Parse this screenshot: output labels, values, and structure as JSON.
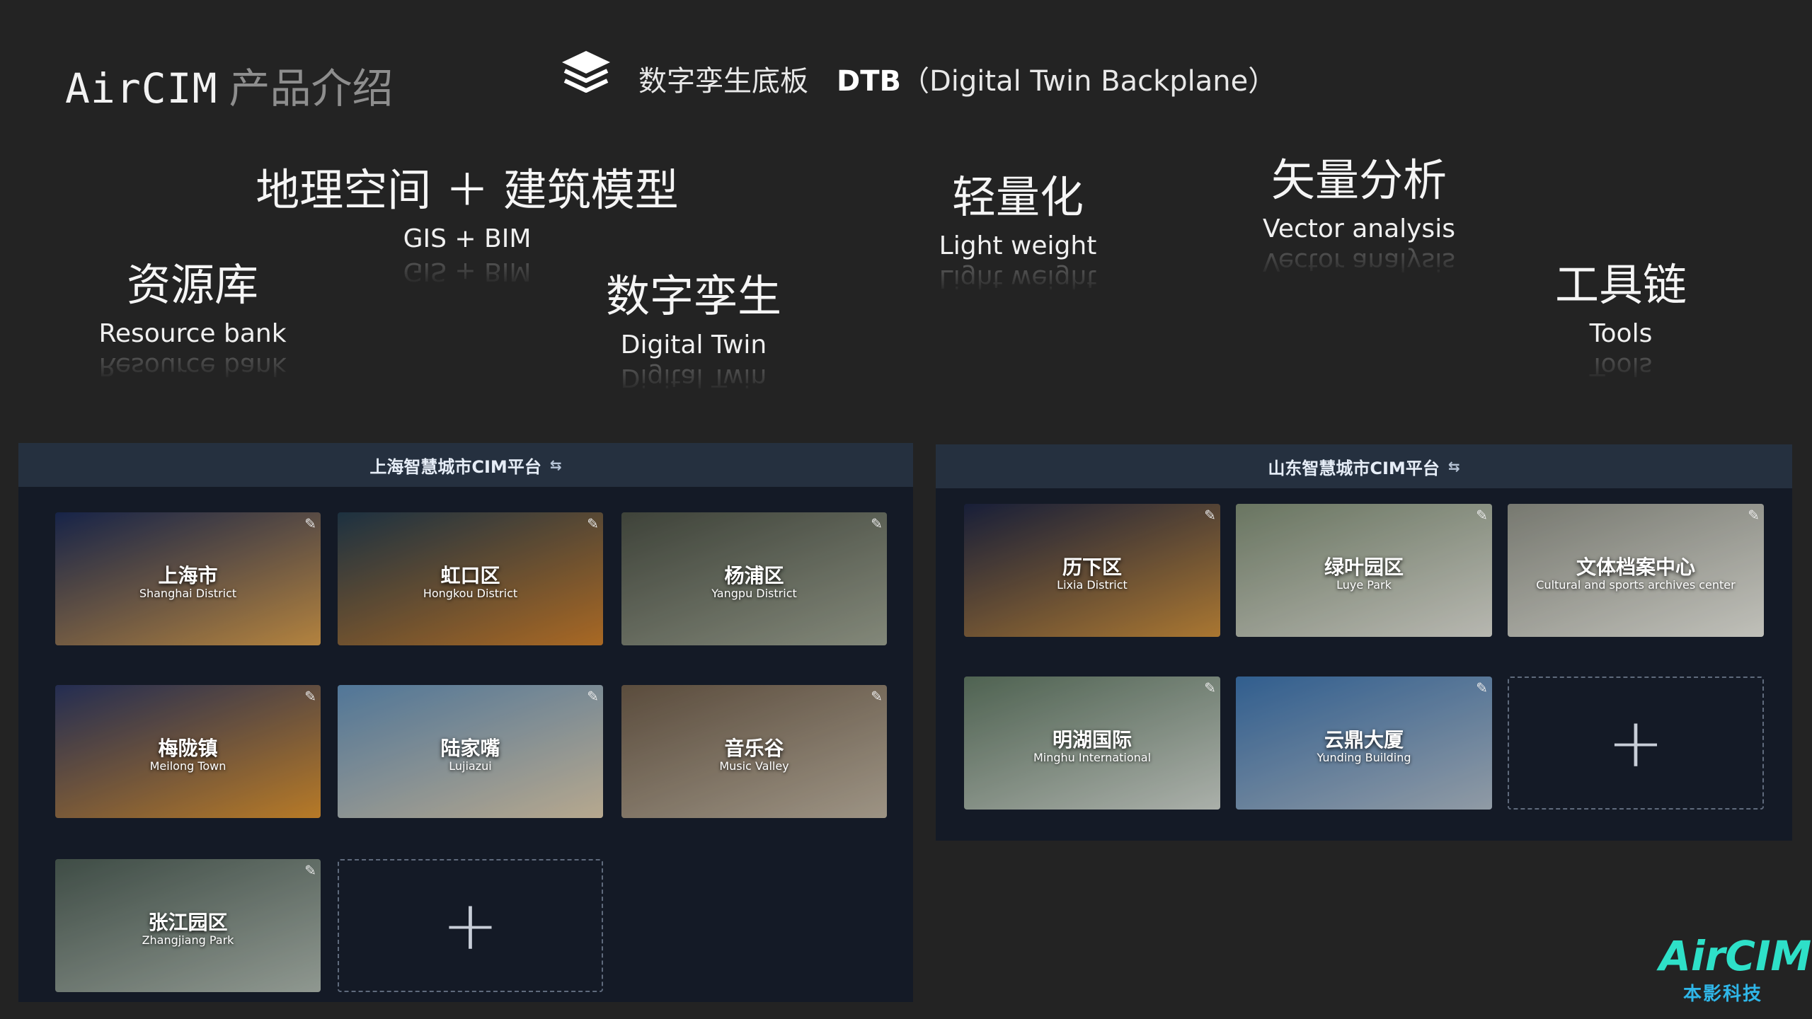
{
  "header": {
    "brand_en": "AirCIM",
    "brand_zh": "产品介绍",
    "subtitle_zh": "数字孪生底板",
    "subtitle_dtb": "DTB",
    "subtitle_full": "（Digital Twin Backplane）",
    "icon": "layers-icon"
  },
  "features": {
    "geo": {
      "zh": "地理空间 ＋ 建筑模型",
      "en": "GIS + BIM"
    },
    "resource": {
      "zh": "资源库",
      "en": "Resource bank"
    },
    "twin": {
      "zh": "数字孪生",
      "en": "Digital Twin"
    },
    "light": {
      "zh": "轻量化",
      "en": "Light weight"
    },
    "vector": {
      "zh": "矢量分析",
      "en": "Vector analysis"
    },
    "tools": {
      "zh": "工具链",
      "en": "Tools"
    }
  },
  "panels": {
    "shanghai": {
      "title": "上海智慧城市CIM平台",
      "swap_icon": "swap-icon",
      "add_label": "+",
      "cards": [
        {
          "zh": "上海市",
          "en": "Shanghai District",
          "c1": "#1b2a55",
          "c2": "#d39a4a"
        },
        {
          "zh": "虹口区",
          "en": "Hongkou District",
          "c1": "#223a4c",
          "c2": "#c77b2a"
        },
        {
          "zh": "杨浦区",
          "en": "Yangpu District",
          "c1": "#4a4f44",
          "c2": "#9aa08f"
        },
        {
          "zh": "梅陇镇",
          "en": "Meilong Town",
          "c1": "#2a3560",
          "c2": "#d8902e"
        },
        {
          "zh": "陆家嘴",
          "en": "Lujiazui",
          "c1": "#5f8bb3",
          "c2": "#d7c6a8"
        },
        {
          "zh": "音乐谷",
          "en": "Music Valley",
          "c1": "#6b5a48",
          "c2": "#b9ae9c"
        },
        {
          "zh": "张江园区",
          "en": "Zhangjiang Park",
          "c1": "#4a5a52",
          "c2": "#a9b3aa"
        }
      ]
    },
    "shandong": {
      "title": "山东智慧城市CIM平台",
      "swap_icon": "swap-icon",
      "add_label": "+",
      "cards": [
        {
          "zh": "历下区",
          "en": "Lixia District",
          "c1": "#1c2442",
          "c2": "#c88c3a"
        },
        {
          "zh": "绿叶园区",
          "en": "Luye Park",
          "c1": "#7c8a72",
          "c2": "#d8d8d0"
        },
        {
          "zh": "文体档案中心",
          "en": "Cultural and sports archives center",
          "c1": "#8c8e84",
          "c2": "#e2e2da"
        },
        {
          "zh": "明湖国际",
          "en": "Minghu International",
          "c1": "#5d7460",
          "c2": "#c9cfc8"
        },
        {
          "zh": "云鼎大厦",
          "en": "Yunding Building",
          "c1": "#3a6fa8",
          "c2": "#aab6c2"
        }
      ]
    }
  },
  "logo": {
    "brand": "AirCIM",
    "company": "本影科技"
  },
  "colors": {
    "background": "#232323",
    "panel": "#141a26",
    "panel_header": "#25303f",
    "logo_cyan": "#2ee0c8",
    "logo_blue": "#2fb6e8"
  }
}
